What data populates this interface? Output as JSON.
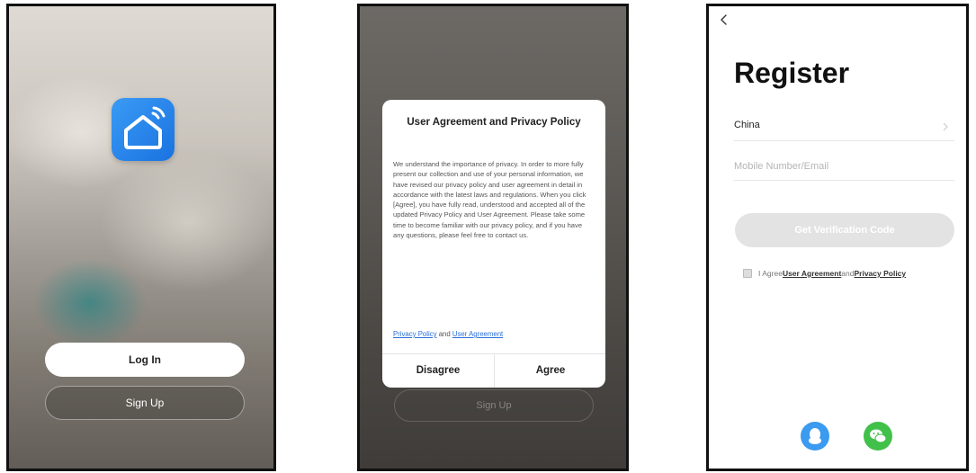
{
  "splash": {
    "login_label": "Log In",
    "signup_label": "Sign Up",
    "app_icon": "smart-home-icon",
    "accent": "#2a8af0"
  },
  "dialog": {
    "title": "User Agreement and Privacy Policy",
    "body": "We understand the importance of privacy. In order to more fully present our collection and use of your personal information, we have revised our privacy policy and user agreement in detail in accordance with the latest laws and regulations. When you click [Agree], you have fully read, understood and accepted all of the updated Privacy Policy and User Agreement. Please take some time to become familiar with our privacy policy, and if you have any questions, please feel free to contact us.",
    "privacy_link": "Privacy Policy",
    "and_text": " and ",
    "agreement_link": "User Agreement",
    "disagree_label": "Disagree",
    "agree_label": "Agree",
    "background_signup_label": "Sign Up"
  },
  "register": {
    "title": "Register",
    "country": "China",
    "mobile_placeholder": "Mobile Number/Email",
    "verify_label": "Get Verification Code",
    "agree_prefix": "I Agree ",
    "agreement_link": "User Agreement",
    "and_text": " and ",
    "privacy_link": "Privacy Policy",
    "social": [
      "qq-icon",
      "wechat-icon"
    ],
    "qq_color": "#3a9bf0",
    "wechat_color": "#41c04a"
  }
}
